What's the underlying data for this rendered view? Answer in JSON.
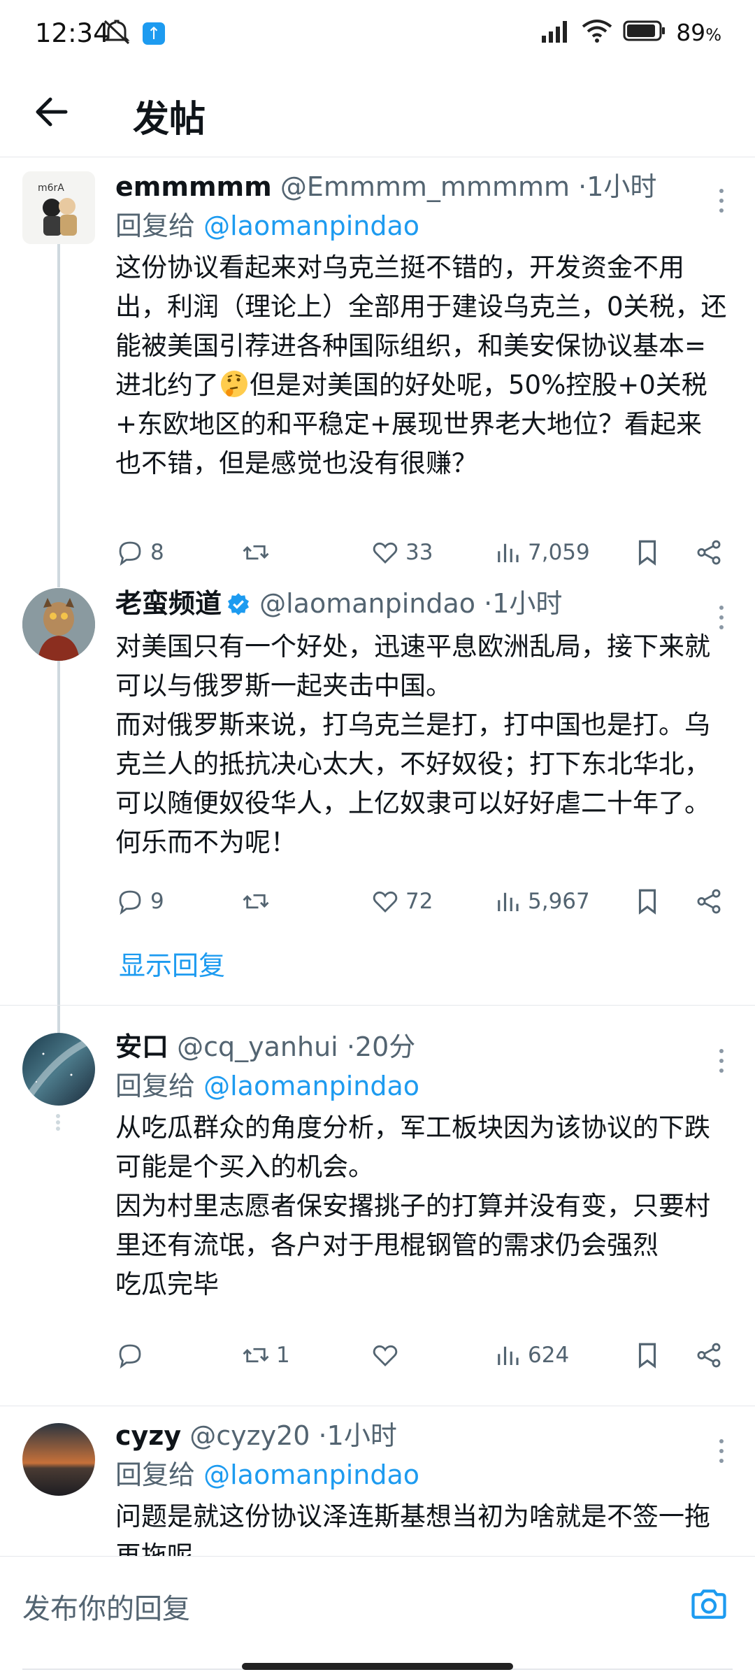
{
  "status_bar": {
    "time": "12:34",
    "battery": "89",
    "battery_unit": "%"
  },
  "header": {
    "title": "发帖"
  },
  "posts": [
    {
      "name": "emmmmm",
      "handle": "@Emmmm_mmmmm",
      "dot": "·",
      "time": "1小时",
      "reply_prefix": "回复给",
      "reply_mention": "@laomanpindao",
      "text_a": "这份协议看起来对乌克兰挺不错的，开发资金不用出，利润（理论上）全部用于建设乌克兰，0关税，还能被美国引荐进各种国际组织，和美安保协议基本=进北约了",
      "text_b": "但是对美国的好处呢，50%控股+0关税+东欧地区的和平稳定+展现世界老大地位？看起来也不错，但是感觉也没有很赚？",
      "emoji": "thinking-face",
      "replies": "8",
      "retweets": "",
      "likes": "33",
      "views": "7,059"
    },
    {
      "name": "老蛮频道",
      "handle": "@laomanpindao",
      "dot": "·",
      "time": "1小时",
      "verified": true,
      "text_lines": [
        "对美国只有一个好处，迅速平息欧洲乱局，接下来就可以与俄罗斯一起夹击中国。",
        "而对俄罗斯来说，打乌克兰是打，打中国也是打。乌克兰人的抵抗决心太大，不好奴役；打下东北华北，可以随便奴役华人，上亿奴隶可以好好虐二十年了。何乐而不为呢！"
      ],
      "replies": "9",
      "retweets": "",
      "likes": "72",
      "views": "5,967"
    },
    {
      "name": "安口",
      "handle": "@cq_yanhui",
      "dot": "·",
      "time": "20分",
      "reply_prefix": "回复给",
      "reply_mention": "@laomanpindao",
      "text_lines": [
        "从吃瓜群众的角度分析，军工板块因为该协议的下跌可能是个买入的机会。",
        "因为村里志愿者保安撂挑子的打算并没有变，只要村里还有流氓，各户对于甩棍钢管的需求仍会强烈",
        "吃瓜完毕"
      ],
      "replies": "",
      "retweets": "1",
      "likes": "",
      "views": "624"
    },
    {
      "name": "cyzy",
      "handle": "@cyzy20",
      "dot": "·",
      "time": "1小时",
      "reply_prefix": "回复给",
      "reply_mention": "@laomanpindao",
      "text_lines": [
        "问题是就这份协议泽连斯基想当初为啥就是不签一拖再拖呢"
      ]
    }
  ],
  "show_replies": "显示回复",
  "composer": {
    "placeholder": "发布你的回复"
  },
  "colors": {
    "accent": "#1d9bf0",
    "secondary_text": "#536471",
    "text": "#0f1419"
  }
}
